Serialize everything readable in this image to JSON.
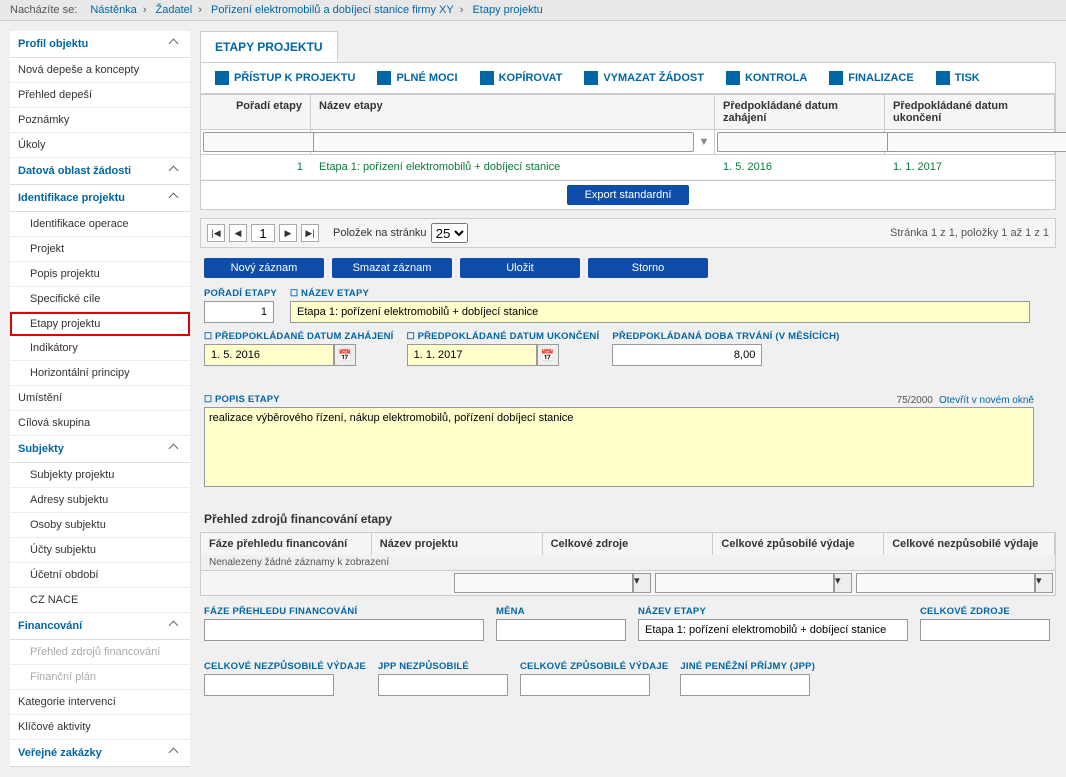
{
  "breadcrumb": {
    "label": "Nacházíte se:",
    "items": [
      "Nástěnka",
      "Žadatel",
      "Pořízení elektromobilů a dobíjecí stanice firmy XY",
      "Etapy projektu"
    ]
  },
  "sidebar": {
    "profil": "Profil objektu",
    "items1": [
      "Nová depeše a koncepty",
      "Přehled depeší",
      "Poznámky",
      "Úkoly"
    ],
    "datova": "Datová oblast žádosti",
    "ident": "Identifikace projektu",
    "ident_items": [
      "Identifikace operace",
      "Projekt",
      "Popis projektu",
      "Specifické cíle",
      "Etapy projektu",
      "Indikátory",
      "Horizontální principy"
    ],
    "items2": [
      "Umístění",
      "Cílová skupina"
    ],
    "subjekty": "Subjekty",
    "subjekty_items": [
      "Subjekty projektu",
      "Adresy subjektu",
      "Osoby subjektu",
      "Účty subjektu",
      "Účetní období",
      "CZ NACE"
    ],
    "financ": "Financování",
    "financ_items_disabled": [
      "Přehled zdrojů financování",
      "Finanční plán"
    ],
    "items3": [
      "Kategorie intervencí",
      "Klíčové aktivity"
    ],
    "verejne": "Veřejné zakázky"
  },
  "tab": {
    "title": "ETAPY PROJEKTU"
  },
  "toolbar": {
    "pristup": "PŘÍSTUP K PROJEKTU",
    "plnemoci": "PLNÉ MOCI",
    "kopirovat": "KOPÍROVAT",
    "vymazat": "VYMAZAT ŽÁDOST",
    "kontrola": "KONTROLA",
    "finalizace": "FINALIZACE",
    "tisk": "TISK"
  },
  "grid": {
    "h_poradi": "Pořadí etapy",
    "h_nazev": "Název etapy",
    "h_date1": "Předpokládané datum zahájení",
    "h_date2": "Předpokládané datum ukončení",
    "row": {
      "poradi": "1",
      "nazev": "Etapa 1: pořízení elektromobilů + dobíjecí stanice",
      "date1": "1. 5. 2016",
      "date2": "1. 1. 2017"
    },
    "export": "Export standardní"
  },
  "pager": {
    "label": "Položek na stránku",
    "per": "25",
    "page": "1",
    "info": "Stránka 1 z 1, položky 1 až 1 z 1"
  },
  "actions": {
    "novy": "Nový záznam",
    "smazat": "Smazat záznam",
    "ulozit": "Uložit",
    "storno": "Storno"
  },
  "form": {
    "l_poradi": "POŘADÍ ETAPY",
    "v_poradi": "1",
    "l_nazev": "NÁZEV ETAPY",
    "v_nazev": "Etapa 1: pořízení elektromobilů + dobíjecí stanice",
    "l_zahajeni": "PŘEDPOKLÁDANÉ DATUM ZAHÁJENÍ",
    "v_zahajeni": "1. 5. 2016",
    "l_ukonceni": "PŘEDPOKLÁDANÉ DATUM UKONČENÍ",
    "v_ukonceni": "1. 1. 2017",
    "l_trvani": "PŘEDPOKLÁDANÁ DOBA TRVÁNÍ (V MĚSÍCÍCH)",
    "v_trvani": "8,00",
    "l_popis": "POPIS ETAPY",
    "v_popis": "realizace výběrového řízení, nákup elektromobilů, pořízení dobíjecí stanice",
    "counter": "75/2000",
    "open_new": "Otevřít v novém okně"
  },
  "fin": {
    "title": "Přehled zdrojů financování etapy",
    "h1": "Fáze přehledu financování",
    "h2": "Název projektu",
    "h3": "Celkové zdroje",
    "h4": "Celkové způsobilé výdaje",
    "h5": "Celkové nezpůsobilé výdaje",
    "empty": "Nenalezeny žádné záznamy k zobrazení"
  },
  "bottom": {
    "l_faze": "FÁZE PŘEHLEDU FINANCOVÁNÍ",
    "l_mena": "MĚNA",
    "l_nazev": "NÁZEV ETAPY",
    "v_nazev": "Etapa 1: pořízení elektromobilů + dobíjecí stanice",
    "l_celkove_zdroje": "CELKOVÉ ZDROJE",
    "l_celkove_nezp": "CELKOVÉ NEZPŮSOBILÉ VÝDAJE",
    "l_jpp_nezp": "JPP NEZPŮSOBILÉ",
    "l_celkove_zp": "CELKOVÉ ZPŮSOBILÉ VÝDAJE",
    "l_jine": "JINÉ PENĚŽNÍ PŘÍJMY (JPP)"
  }
}
